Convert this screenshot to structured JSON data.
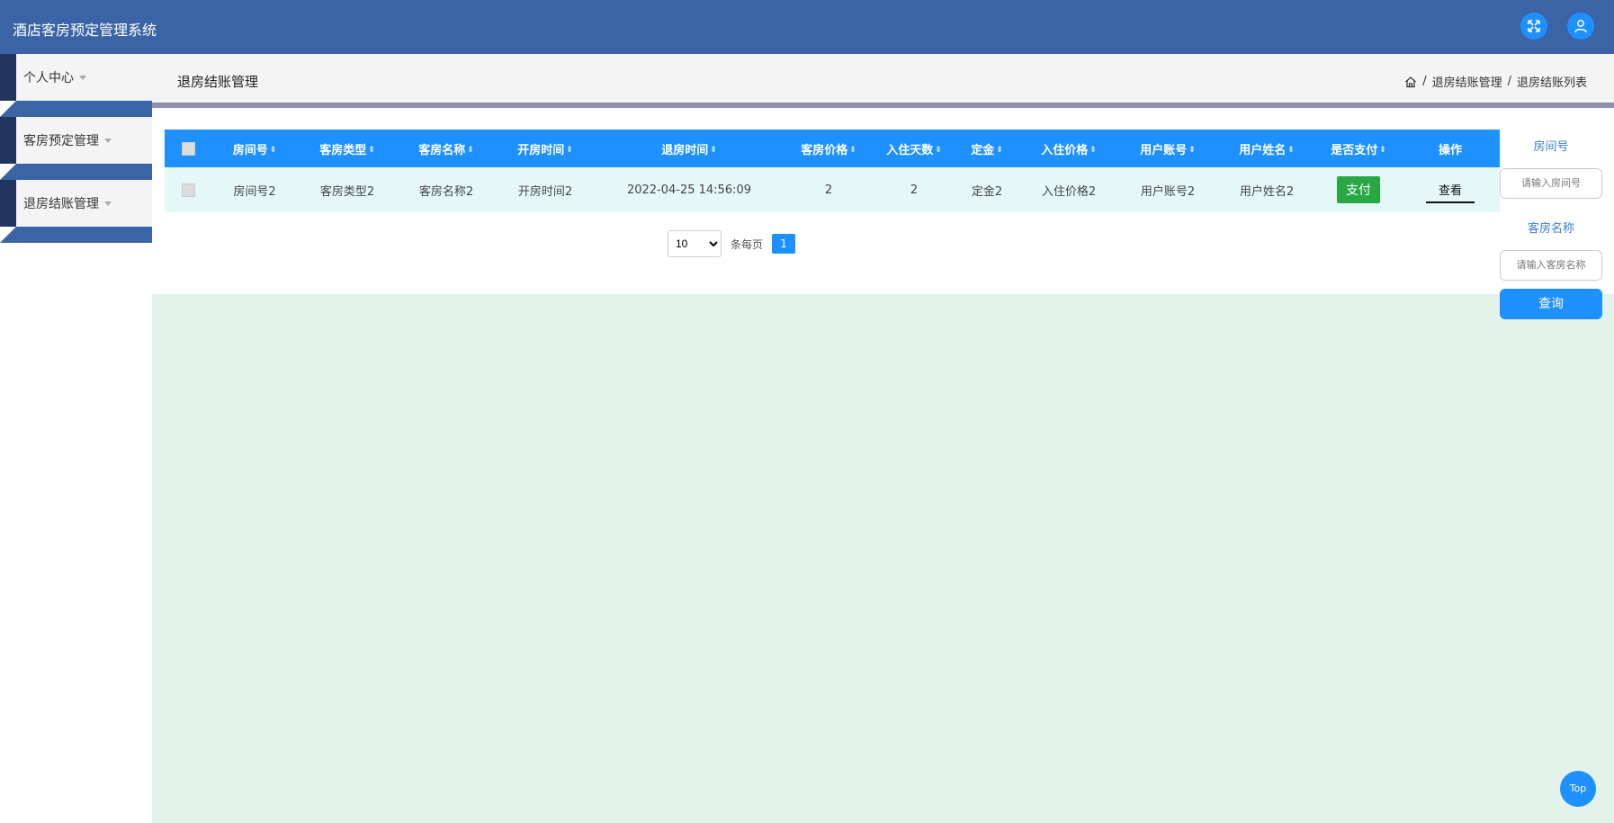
{
  "app": {
    "title": "酒店客房预定管理系统"
  },
  "header": {
    "fullscreen_icon": "fullscreen-icon",
    "user_icon": "user-icon",
    "accent": "#3a64a6",
    "button_color": "#1e90ff"
  },
  "sidebar": {
    "items": [
      {
        "label": "个人中心"
      },
      {
        "label": "客房预定管理"
      },
      {
        "label": "退房结账管理"
      }
    ]
  },
  "page": {
    "title": "退房结账管理",
    "breadcrumb": [
      "退房结账管理",
      "退房结账列表"
    ],
    "home_icon": "home-icon"
  },
  "table": {
    "columns": [
      "房间号",
      "客房类型",
      "客房名称",
      "开房时间",
      "退房时间",
      "客房价格",
      "入住天数",
      "定金",
      "入住价格",
      "用户账号",
      "用户姓名",
      "是否支付",
      "操作"
    ],
    "rows": [
      {
        "room_no": "房间号2",
        "room_type": "客房类型2",
        "room_name": "客房名称2",
        "open_time": "开房时间2",
        "checkout_time": "2022-04-25 14:56:09",
        "room_price": "2",
        "days": "2",
        "deposit": "定金2",
        "stay_price": "入住价格2",
        "user_account": "用户账号2",
        "user_name": "用户姓名2",
        "pay_label": "支付",
        "view_label": "查看"
      }
    ]
  },
  "pagination": {
    "page_size": "10",
    "page_size_options": [
      "10"
    ],
    "per_page_label": "条每页",
    "current_page": "1"
  },
  "search": {
    "room_no_label": "房间号",
    "room_no_placeholder": "请输入房间号",
    "room_name_label": "客房名称",
    "room_name_placeholder": "请输入客房名称",
    "query_label": "查询"
  },
  "top_button": {
    "label": "Top"
  }
}
